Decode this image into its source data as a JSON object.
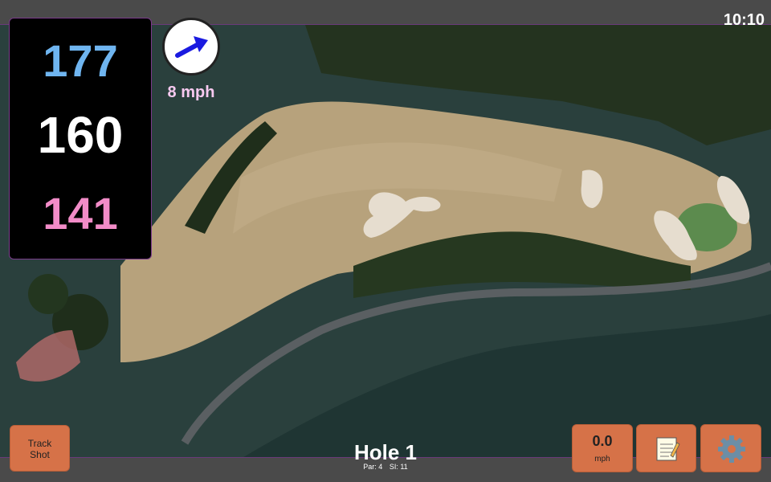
{
  "clock": "10:10",
  "yardage": {
    "back": "177",
    "middle": "160",
    "front": "141"
  },
  "wind": {
    "speed": "8 mph",
    "icon": "wind-arrow-icon",
    "direction": "north-east"
  },
  "buttons": {
    "track_shot": "Track\nShot",
    "speed_value": "0.0",
    "speed_unit": "mph",
    "notes_icon": "notepad-icon",
    "settings_icon": "gear-icon"
  },
  "hole": {
    "title": "Hole 1",
    "par": "Par: 4",
    "si": "SI: 11"
  },
  "colors": {
    "back_yardage": "#6fb5f0",
    "middle_yardage": "#ffffff",
    "front_yardage": "#f28cc8",
    "wind_text": "#f7c9f0",
    "button_fill": "#d67248"
  }
}
